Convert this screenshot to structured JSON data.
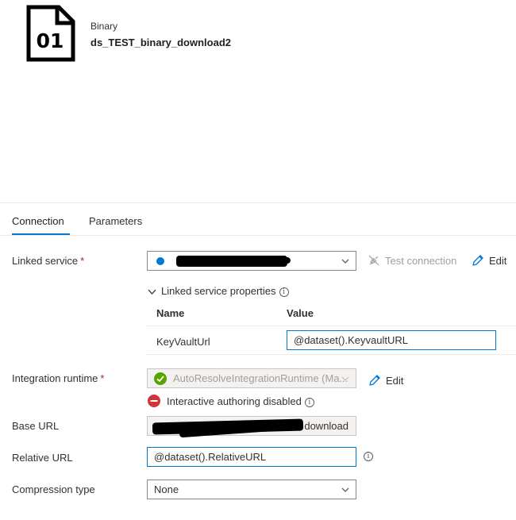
{
  "header": {
    "icon_text": "01",
    "type": "Binary",
    "name": "ds_TEST_binary_download2"
  },
  "tabs": [
    {
      "label": "Connection",
      "active": true
    },
    {
      "label": "Parameters",
      "active": false
    }
  ],
  "linked_service": {
    "label": "Linked service",
    "required_mark": "*",
    "test_connection_label": "Test connection",
    "edit_label": "Edit",
    "properties_toggle_label": "Linked service properties",
    "table_headers": {
      "name": "Name",
      "value": "Value"
    },
    "rows": [
      {
        "name": "KeyVaultUrl",
        "value": "@dataset().KeyvaultURL"
      }
    ]
  },
  "integration_runtime": {
    "label": "Integration runtime",
    "required_mark": "*",
    "value": "AutoResolveIntegrationRuntime (Ma...",
    "edit_label": "Edit",
    "warning": "Interactive authoring disabled"
  },
  "base_url": {
    "label": "Base URL",
    "value_tail": "download"
  },
  "relative_url": {
    "label": "Relative URL",
    "value": "@dataset().RelativeURL"
  },
  "compression": {
    "label": "Compression type",
    "value": "None"
  },
  "icons": {
    "file": "binary-file-icon",
    "info": "info-icon",
    "chevron": "chevron-down-icon",
    "edit": "pencil-icon",
    "test": "plug-icon",
    "check": "check-circle-icon",
    "error": "error-circle-icon"
  },
  "colors": {
    "accent": "#0078d4",
    "required": "#a4262c",
    "success": "#57a300",
    "error": "#d13438",
    "disabled_text": "#a19f9d"
  },
  "info_glyph": "i"
}
